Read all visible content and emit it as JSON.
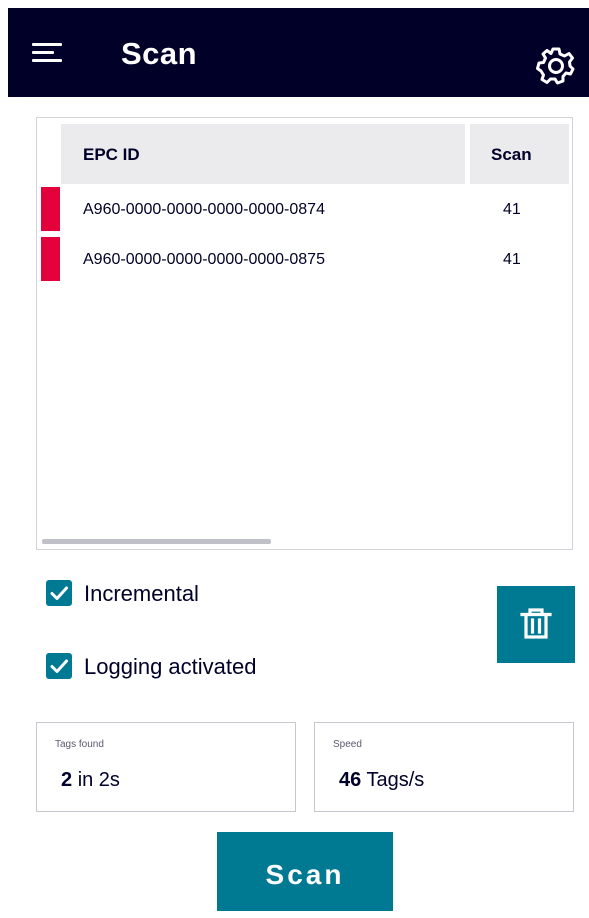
{
  "header": {
    "title": "Scan",
    "menu_icon": "hamburger-menu-icon",
    "settings_icon": "gear-icon"
  },
  "table": {
    "columns": [
      "EPC ID",
      "Scan"
    ],
    "rows": [
      {
        "epc": "A960-0000-0000-0000-0000-0874",
        "scan": "41",
        "status_color": "#e4003a"
      },
      {
        "epc": "A960-0000-0000-0000-0000-0875",
        "scan": "41",
        "status_color": "#e4003a"
      }
    ]
  },
  "options": {
    "incremental": {
      "label": "Incremental",
      "checked": true
    },
    "logging": {
      "label": "Logging activated",
      "checked": true
    }
  },
  "delete_icon": "trash-icon",
  "stats": {
    "tags_found": {
      "label": "Tags found",
      "value": "2",
      "unit": "in 2s"
    },
    "speed": {
      "label": "Speed",
      "value": "46",
      "unit": "Tags/s"
    }
  },
  "scan_button": {
    "label": "Scan"
  },
  "colors": {
    "header_bg": "#000028",
    "accent": "#007993",
    "status_red": "#e4003a"
  }
}
